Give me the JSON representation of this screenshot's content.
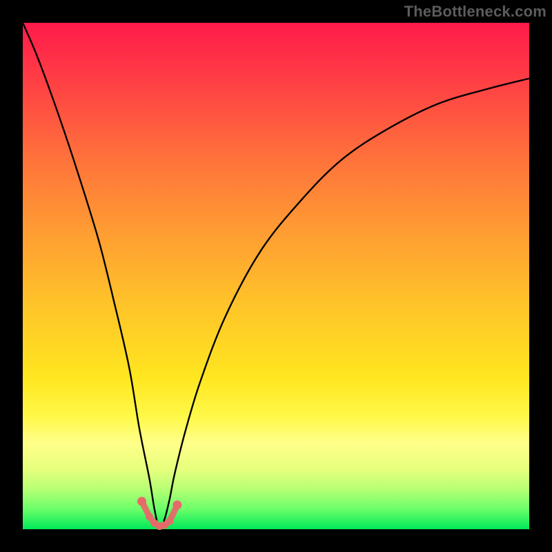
{
  "watermark": "TheBottleneck.com",
  "chart_data": {
    "type": "line",
    "title": "",
    "xlabel": "",
    "ylabel": "",
    "xlim": [
      0,
      100
    ],
    "ylim": [
      0,
      100
    ],
    "background_gradient": {
      "top_color": "#ff1a4b",
      "bottom_color": "#00e858",
      "meaning": "red (top) = high bottleneck, green (bottom) = low bottleneck"
    },
    "series": [
      {
        "name": "bottleneck-curve",
        "note": "V-shaped curve; minimum at x≈27 where bottleneck≈0. Values read off vertical position (0=bottom/green, 100=top/red).",
        "x": [
          0,
          3,
          7,
          11,
          15,
          18,
          21,
          23,
          25,
          26,
          27,
          28,
          29,
          30,
          32,
          35,
          40,
          47,
          55,
          63,
          72,
          82,
          92,
          100
        ],
        "values": [
          100,
          93,
          82,
          70,
          57,
          45,
          32,
          20,
          10,
          4,
          0,
          2,
          6,
          11,
          19,
          29,
          42,
          55,
          65,
          73,
          79,
          84,
          87,
          89
        ]
      },
      {
        "name": "highlight-dots",
        "note": "Salmon dots/segment near the curve minimum",
        "x": [
          23.5,
          25.0,
          26.0,
          27.0,
          28.0,
          29.0,
          30.5
        ],
        "values": [
          5.5,
          2.5,
          1.2,
          0.6,
          0.8,
          1.6,
          4.8
        ]
      }
    ]
  },
  "colors": {
    "curve": "#000000",
    "dots": "#e66a6a",
    "frame": "#000000"
  }
}
